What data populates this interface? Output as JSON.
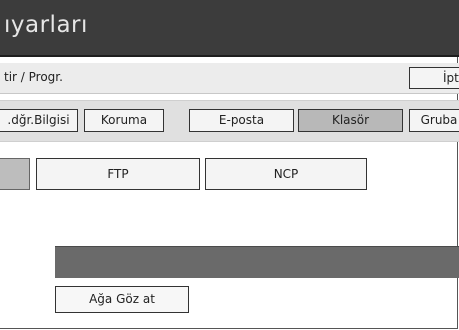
{
  "header": {
    "title": "ıyarları"
  },
  "subbar": {
    "path": "tir / Progr.",
    "cancel_label": "İpt"
  },
  "tabs": [
    {
      "label": ".dğr.Bilgisi",
      "selected": false
    },
    {
      "label": "Koruma",
      "selected": false
    },
    {
      "label": "E-posta",
      "selected": false
    },
    {
      "label": "Klasör",
      "selected": true
    },
    {
      "label": "Gruba",
      "selected": false
    }
  ],
  "protocols": [
    {
      "label": "FTP"
    },
    {
      "label": "NCP"
    }
  ],
  "browse_button": {
    "label": "Ağa Göz at"
  }
}
